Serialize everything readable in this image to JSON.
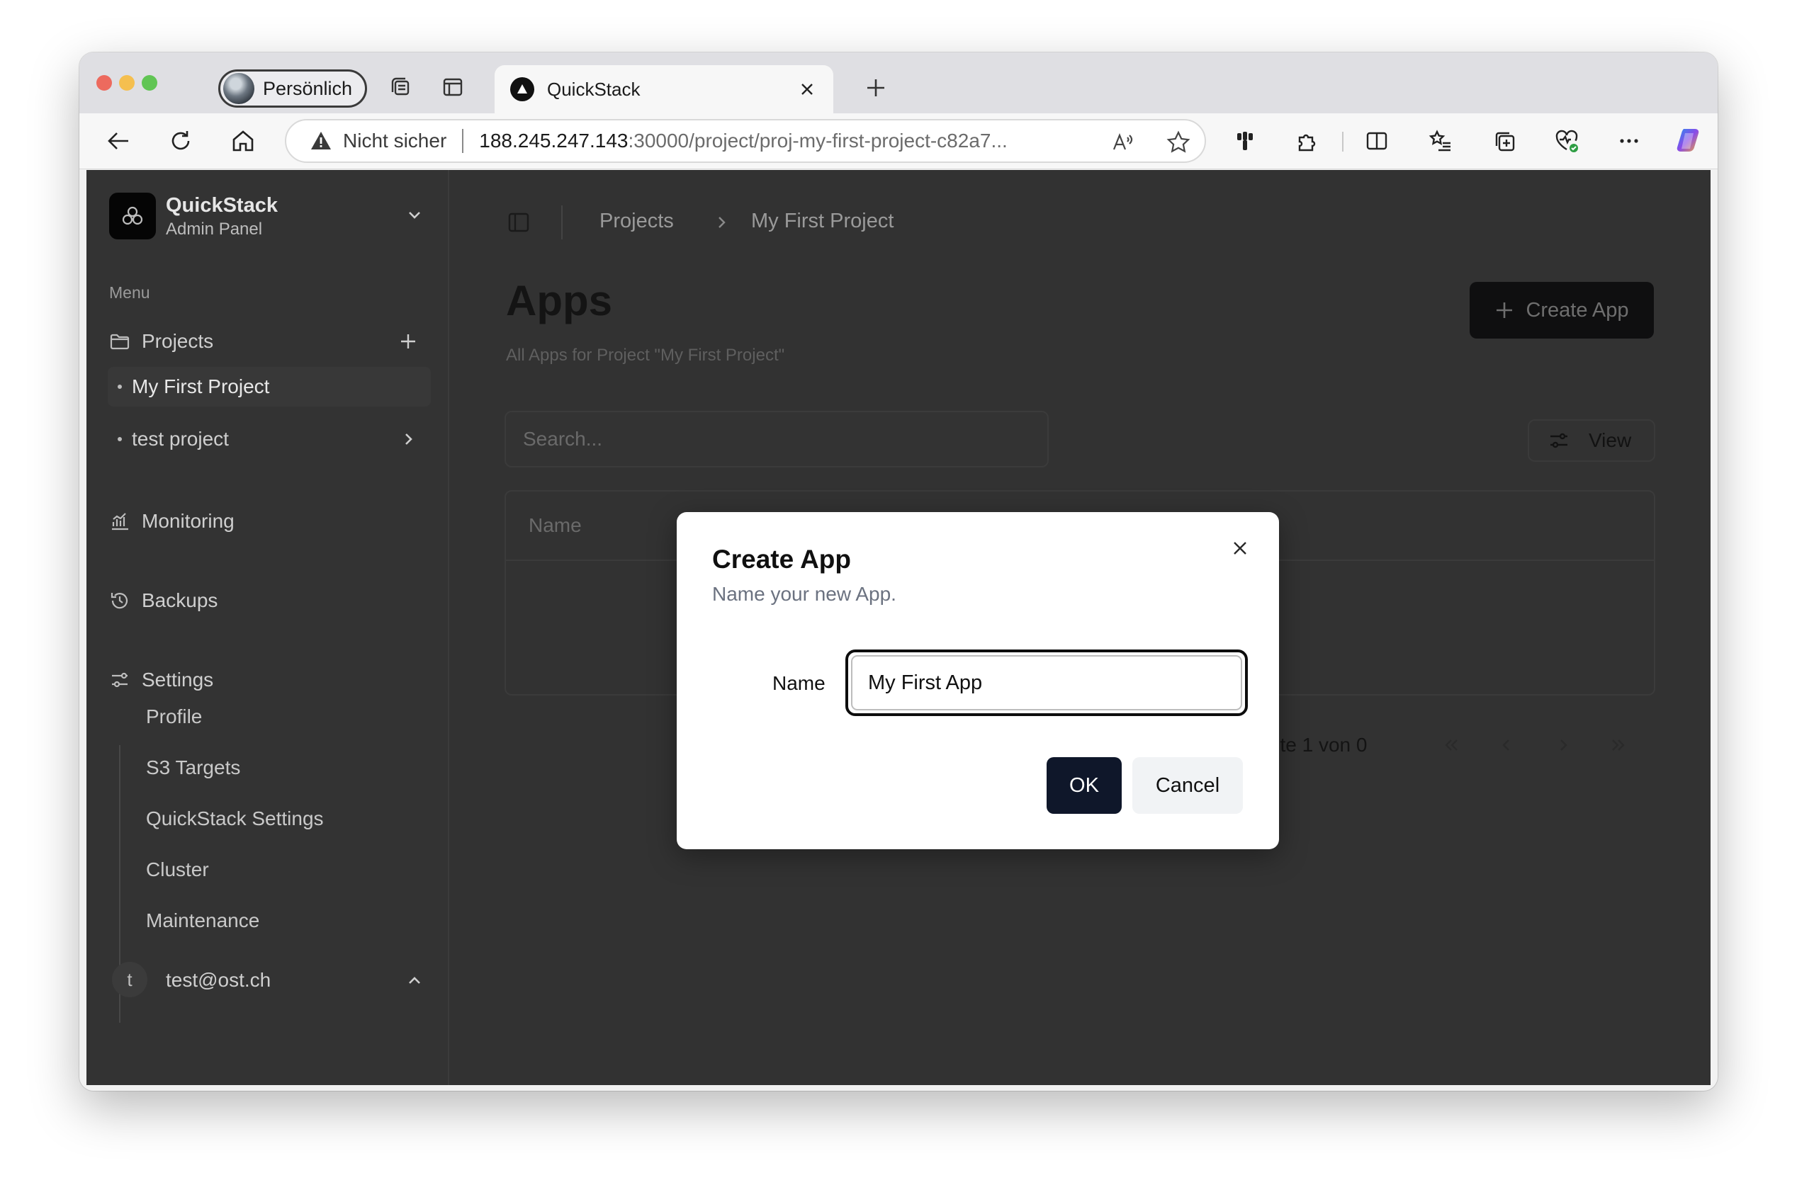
{
  "browser": {
    "profile_label": "Persönlich",
    "tab_title": "QuickStack",
    "security_label": "Nicht sicher",
    "url_host": "188.245.247.143",
    "url_path": ":30000/project/proj-my-first-project-c82a7..."
  },
  "sidebar": {
    "brand_name": "QuickStack",
    "brand_sub": "Admin Panel",
    "menu_label": "Menu",
    "projects_label": "Projects",
    "project_items": [
      "My First Project",
      "test project"
    ],
    "monitoring_label": "Monitoring",
    "backups_label": "Backups",
    "settings_label": "Settings",
    "settings_items": [
      "Profile",
      "S3 Targets",
      "QuickStack Settings",
      "Cluster",
      "Maintenance"
    ],
    "user_initial": "t",
    "user_email": "test@ost.ch"
  },
  "main": {
    "breadcrumb": [
      "Projects",
      "My First Project"
    ],
    "title": "Apps",
    "subtitle": "All Apps for Project \"My First Project\"",
    "create_button": "Create App",
    "search_placeholder": "Search...",
    "view_button": "View",
    "table_header": "Name",
    "page_info": "Seite 1 von 0"
  },
  "modal": {
    "title": "Create App",
    "description": "Name your new App.",
    "name_label": "Name",
    "name_value": "My First App",
    "ok_label": "OK",
    "cancel_label": "Cancel"
  },
  "colors": {
    "overlay_bg": "#323232",
    "primary_button": "#0f172a",
    "modal_bg": "#ffffff"
  }
}
